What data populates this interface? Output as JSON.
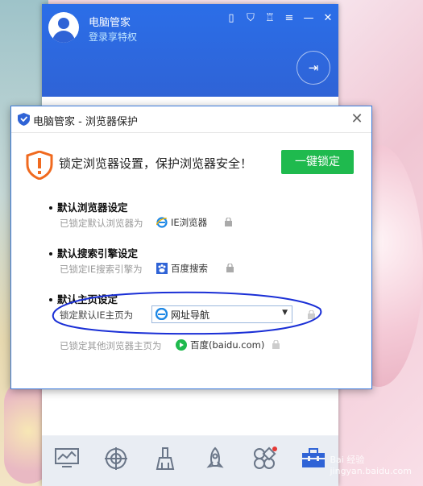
{
  "app": {
    "title": "电脑管家",
    "subtitle": "登录享特权"
  },
  "dialog": {
    "title": "电脑管家 - 浏览器保护",
    "hero_text": "锁定浏览器设置，保护浏览器安全！",
    "lock_button": "一键锁定",
    "sections": [
      {
        "heading": "默认浏览器设定",
        "label": "已锁定默认浏览器为",
        "value": "IE浏览器"
      },
      {
        "heading": "默认搜索引擎设定",
        "label": "已锁定IE搜索引擎为",
        "value": "百度搜索"
      },
      {
        "heading": "默认主页设定",
        "label": "锁定默认IE主页为",
        "value": "网址导航",
        "extra_label": "已锁定其他浏览器主页为",
        "extra_value": "百度(baidu.com)"
      }
    ]
  },
  "footer_tools": [
    "chart-icon",
    "target-icon",
    "broom-icon",
    "rocket-icon",
    "toolbox-icon"
  ],
  "colors": {
    "header_blue": "#2f63d6",
    "accent_green": "#1fba4e",
    "annotation_blue": "#1a2fd6"
  },
  "watermark": "Bai 经验\njingyan.baidu.com"
}
